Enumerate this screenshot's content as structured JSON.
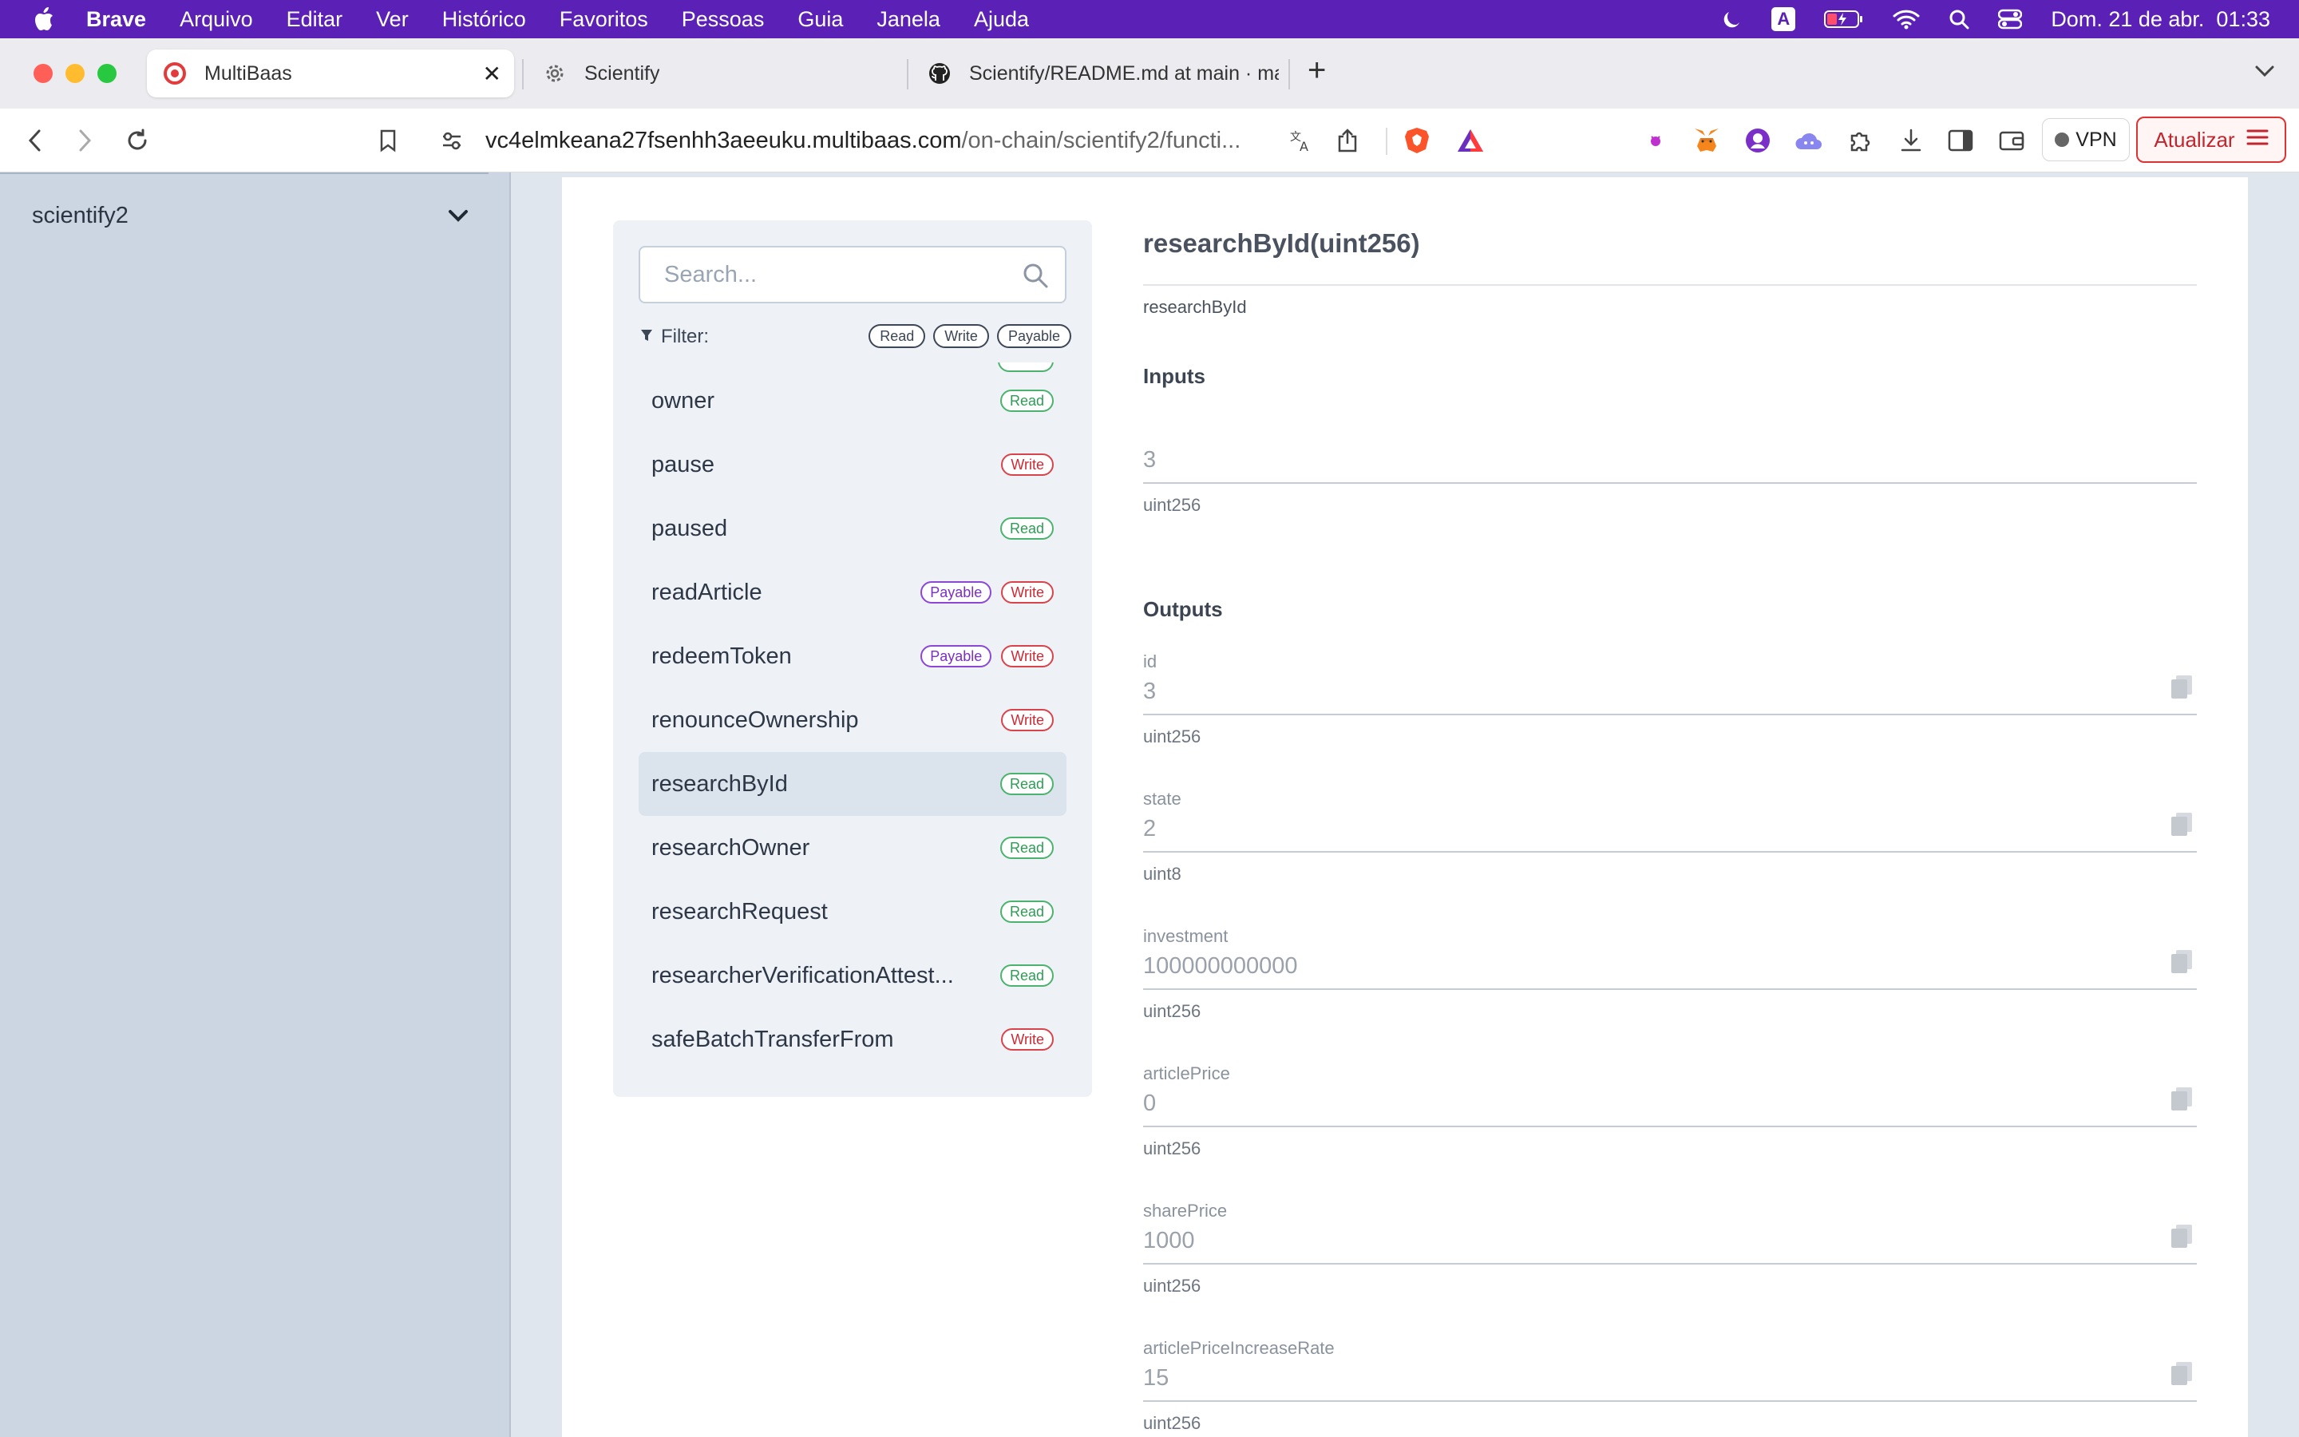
{
  "menubar": {
    "app": "Brave",
    "items": [
      "Arquivo",
      "Editar",
      "Ver",
      "Histórico",
      "Favoritos",
      "Pessoas",
      "Guia",
      "Janela",
      "Ajuda"
    ],
    "keyboard_badge": "A",
    "datetime": "Dom. 21 de abr.  01:33"
  },
  "tabs": [
    {
      "title": "MultiBaas",
      "icon": "multibaas-icon"
    },
    {
      "title": "Scientify",
      "icon": "gear-icon"
    },
    {
      "title": "Scientify/README.md at main · ma",
      "icon": "github-icon"
    }
  ],
  "toolbar": {
    "url_host": "vc4elmkeana27fsenhh3aeeuku.multibaas.com",
    "url_path": "/on-chain/scientify2/functi...",
    "vpn_label": "VPN",
    "update_label": "Atualizar"
  },
  "sidebar": {
    "project_name": "scientify2"
  },
  "functions_panel": {
    "search_placeholder": "Search...",
    "filter_label": "Filter:",
    "filter_chips": [
      "Read",
      "Write",
      "Payable"
    ],
    "items": [
      {
        "name": "owner",
        "badges": [
          "Read"
        ]
      },
      {
        "name": "pause",
        "badges": [
          "Write"
        ]
      },
      {
        "name": "paused",
        "badges": [
          "Read"
        ]
      },
      {
        "name": "readArticle",
        "badges": [
          "Payable",
          "Write"
        ]
      },
      {
        "name": "redeemToken",
        "badges": [
          "Payable",
          "Write"
        ]
      },
      {
        "name": "renounceOwnership",
        "badges": [
          "Write"
        ]
      },
      {
        "name": "researchById",
        "badges": [
          "Read"
        ],
        "selected": true
      },
      {
        "name": "researchOwner",
        "badges": [
          "Read"
        ]
      },
      {
        "name": "researchRequest",
        "badges": [
          "Read"
        ]
      },
      {
        "name": "researcherVerificationAttest...",
        "badges": [
          "Read"
        ]
      },
      {
        "name": "safeBatchTransferFrom",
        "badges": [
          "Write"
        ]
      }
    ]
  },
  "detail": {
    "signature": "researchById(uint256)",
    "name": "researchById",
    "inputs_heading": "Inputs",
    "input": {
      "value": "3",
      "type": "uint256"
    },
    "outputs_heading": "Outputs",
    "outputs": [
      {
        "label": "id",
        "value": "3",
        "type": "uint256"
      },
      {
        "label": "state",
        "value": "2",
        "type": "uint8"
      },
      {
        "label": "investment",
        "value": "100000000000",
        "type": "uint256"
      },
      {
        "label": "articlePrice",
        "value": "0",
        "type": "uint256"
      },
      {
        "label": "sharePrice",
        "value": "1000",
        "type": "uint256"
      },
      {
        "label": "articlePriceIncreaseRate",
        "value": "15",
        "type": "uint256"
      }
    ]
  },
  "colors": {
    "menubar": "#5b21b6",
    "read": "#2f9b55",
    "write": "#cc2b35",
    "payable": "#7b2fc9"
  }
}
